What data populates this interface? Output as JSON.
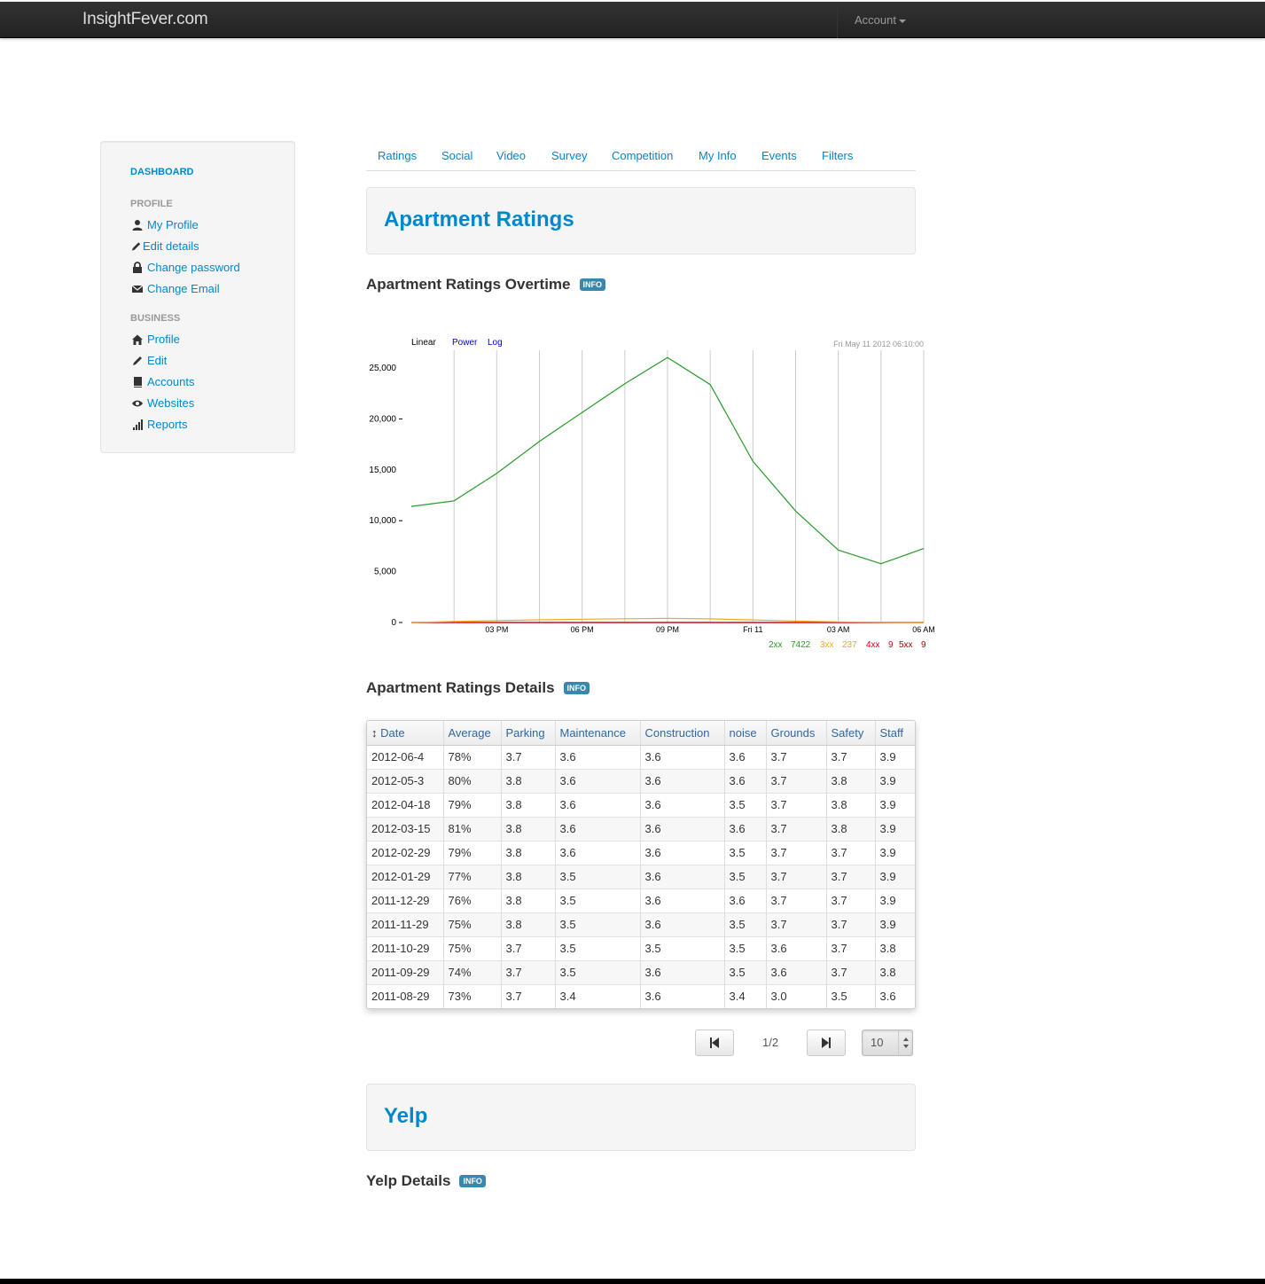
{
  "navbar": {
    "brand": "InsightFever.com",
    "account_label": "Account"
  },
  "sidebar": {
    "dashboard": "DASHBOARD",
    "profile_header": "PROFILE",
    "profile_items": [
      {
        "label": "My Profile",
        "icon": "user-icon"
      },
      {
        "label": "Edit details",
        "icon": "pencil-icon"
      },
      {
        "label": "Change password",
        "icon": "lock-icon"
      },
      {
        "label": "Change Email",
        "icon": "envelope-icon"
      }
    ],
    "business_header": "BUSINESS",
    "business_items": [
      {
        "label": "Profile",
        "icon": "home-icon"
      },
      {
        "label": "Edit",
        "icon": "pencil-icon"
      },
      {
        "label": "Accounts",
        "icon": "book-icon"
      },
      {
        "label": "Websites",
        "icon": "eye-icon"
      },
      {
        "label": "Reports",
        "icon": "signal-icon"
      }
    ]
  },
  "tabs": [
    "Ratings",
    "Social",
    "Video",
    "Survey",
    "Competition",
    "My Info",
    "Events",
    "Filters"
  ],
  "ratings_hero": "Apartment Ratings",
  "overtime_title": "Apartment Ratings Overtime",
  "info_badge": "INFO",
  "chart_data": {
    "type": "line",
    "scale_options": [
      "Linear",
      "Power",
      "Log"
    ],
    "selected_scale": "Linear",
    "timestamp": "Fri May 11 2012 06:10:00",
    "y_ticks": [
      "25,000",
      "20,000",
      "15,000",
      "10,000",
      "5,000",
      "0"
    ],
    "ylim": [
      0,
      25000
    ],
    "x_ticks": [
      "03 PM",
      "06 PM",
      "09 PM",
      "Fri 11",
      "03 AM",
      "06 AM"
    ],
    "x": [
      0,
      3,
      6,
      9,
      12,
      15,
      18
    ],
    "series": [
      {
        "name": "2xx",
        "total": "7422",
        "color": "#2a9a2a",
        "values": [
          11400,
          12100,
          14800,
          17800,
          20500,
          23300,
          26000,
          23500,
          16000,
          11000,
          7000,
          5600,
          7200
        ]
      },
      {
        "name": "3xx",
        "total": "237",
        "color": "#f5a623",
        "values": [
          0,
          100,
          180,
          260,
          320,
          370,
          400,
          360,
          250,
          140,
          60,
          20,
          0
        ]
      },
      {
        "name": "4xx",
        "total": "9",
        "color": "#d0021b",
        "values": [
          0,
          0,
          0,
          0,
          0,
          0,
          0,
          0,
          0,
          0,
          0,
          0,
          0
        ]
      },
      {
        "name": "5xx",
        "total": "9",
        "color": "#b00000",
        "values": [
          0,
          0,
          0,
          0,
          0,
          0,
          0,
          0,
          0,
          0,
          0,
          0,
          0
        ]
      }
    ]
  },
  "details_title": "Apartment Ratings Details",
  "table": {
    "headers": [
      "Date",
      "Average",
      "Parking",
      "Maintenance",
      "Construction",
      "noise",
      "Grounds",
      "Safety",
      "Staff"
    ],
    "rows": [
      [
        "2012-06-4",
        "78%",
        "3.7",
        "3.6",
        "3.6",
        "3.6",
        "3.7",
        "3.7",
        "3.9"
      ],
      [
        "2012-05-3",
        "80%",
        "3.8",
        "3.6",
        "3.6",
        "3.6",
        "3.7",
        "3.8",
        "3.9"
      ],
      [
        "2012-04-18",
        "79%",
        "3.8",
        "3.6",
        "3.6",
        "3.5",
        "3.7",
        "3.8",
        "3.9"
      ],
      [
        "2012-03-15",
        "81%",
        "3.8",
        "3.6",
        "3.6",
        "3.6",
        "3.7",
        "3.8",
        "3.9"
      ],
      [
        "2012-02-29",
        "79%",
        "3.8",
        "3.6",
        "3.6",
        "3.5",
        "3.7",
        "3.7",
        "3.9"
      ],
      [
        "2012-01-29",
        "77%",
        "3.8",
        "3.5",
        "3.6",
        "3.5",
        "3.7",
        "3.7",
        "3.9"
      ],
      [
        "2011-12-29",
        "76%",
        "3.8",
        "3.5",
        "3.6",
        "3.6",
        "3.7",
        "3.7",
        "3.9"
      ],
      [
        "2011-11-29",
        "75%",
        "3.8",
        "3.5",
        "3.6",
        "3.5",
        "3.7",
        "3.7",
        "3.9"
      ],
      [
        "2011-10-29",
        "75%",
        "3.7",
        "3.5",
        "3.5",
        "3.5",
        "3.6",
        "3.7",
        "3.8"
      ],
      [
        "2011-09-29",
        "74%",
        "3.7",
        "3.5",
        "3.6",
        "3.5",
        "3.6",
        "3.7",
        "3.8"
      ],
      [
        "2011-08-29",
        "73%",
        "3.7",
        "3.4",
        "3.6",
        "3.4",
        "3.0",
        "3.5",
        "3.6"
      ]
    ]
  },
  "pager": {
    "page_text": "1/2",
    "page_size": "10"
  },
  "yelp_hero": "Yelp",
  "yelp_details_title": "Yelp Details"
}
